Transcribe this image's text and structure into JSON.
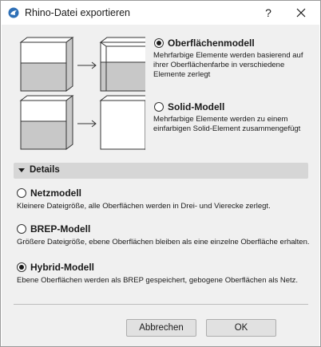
{
  "window": {
    "title": "Rhino-Datei exportieren",
    "help_label": "?"
  },
  "icons": {
    "app": "rhino-app-icon",
    "close": "close-icon",
    "arrow": "right-arrow-icon",
    "details_toggle": "triangle-down-icon"
  },
  "export_mode": {
    "options": [
      {
        "label": "Oberflächenmodell",
        "checked": true,
        "description": "Mehrfarbige Elemente werden basierend auf ihrer Oberflächenfarbe in verschiedene Elemente zerlegt"
      },
      {
        "label": "Solid-Modell",
        "checked": false,
        "description": "Mehrfarbige Elemente werden zu einem einfarbigen Solid-Element zusammengefügt"
      }
    ]
  },
  "details": {
    "label": "Details",
    "expanded": true,
    "options": [
      {
        "label": "Netzmodell",
        "checked": false,
        "description": "Kleinere Dateigröße, alle Oberflächen werden in Drei- und Vierecke zerlegt."
      },
      {
        "label": "BREP-Modell",
        "checked": false,
        "description": "Größere Dateigröße, ebene Oberflächen bleiben als eine einzelne Oberfläche erhalten."
      },
      {
        "label": "Hybrid-Modell",
        "checked": true,
        "description": "Ebene Oberflächen werden als BREP gespeichert, gebogene Oberflächen als Netz."
      }
    ]
  },
  "buttons": {
    "cancel_label": "Abbrechen",
    "ok_label": "OK"
  },
  "colors": {
    "box_top": "#ffffff",
    "box_bottom": "#c8c8c8",
    "box_outline": "#333333"
  }
}
